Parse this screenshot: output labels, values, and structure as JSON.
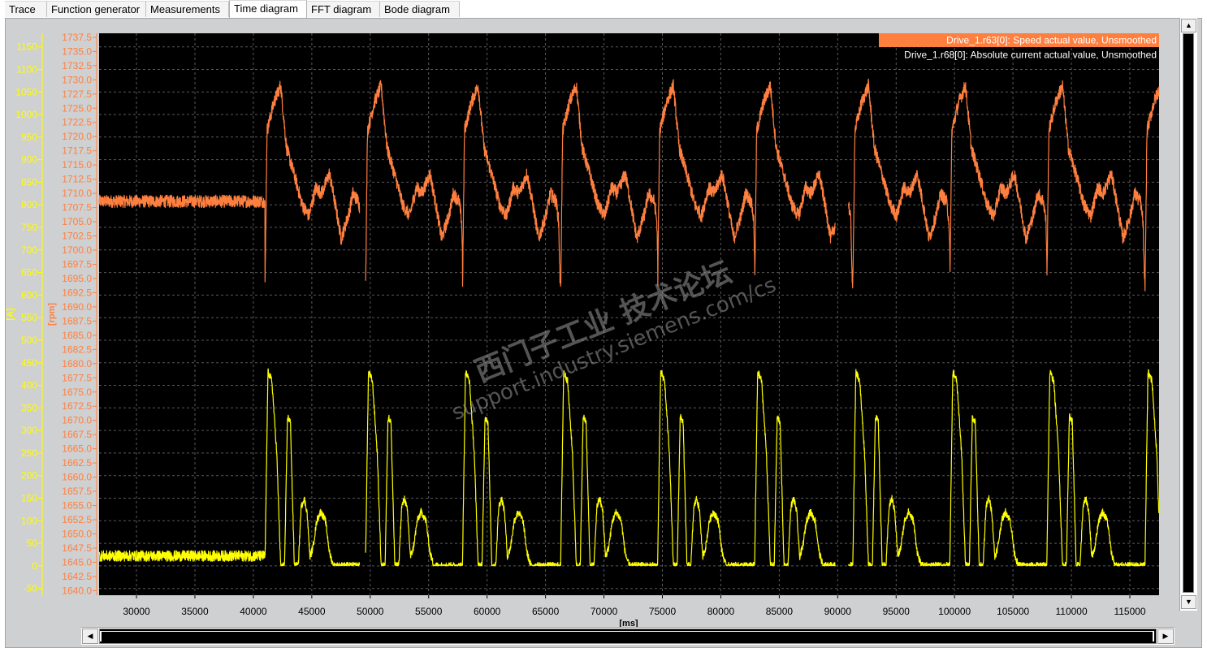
{
  "tabs": [
    {
      "label": "Trace",
      "active": false
    },
    {
      "label": "Function generator",
      "active": false
    },
    {
      "label": "Measurements",
      "active": false
    },
    {
      "label": "Time diagram",
      "active": true
    },
    {
      "label": "FFT diagram",
      "active": false
    },
    {
      "label": "Bode diagram",
      "active": false
    }
  ],
  "scroll_icons": {
    "up": "▲",
    "down": "▼",
    "left": "◀",
    "right": "▶"
  },
  "chart_data": {
    "type": "line",
    "xlabel": "[ms]",
    "xlim": [
      26800,
      117500
    ],
    "x_ticks": [
      30000,
      35000,
      40000,
      45000,
      50000,
      55000,
      60000,
      65000,
      70000,
      75000,
      80000,
      85000,
      90000,
      95000,
      100000,
      105000,
      110000,
      115000
    ],
    "grid": true,
    "legend_position": "top-right",
    "colors": {
      "speed": "#ff7f3f",
      "current": "#ffff00",
      "background": "#000000",
      "grid": "#5a5a5a"
    },
    "axes": [
      {
        "id": "current",
        "label": "[A]",
        "color": "#ffff00",
        "ylim": [
          -65,
          1180
        ],
        "ticks": [
          -50,
          0,
          50,
          100,
          150,
          200,
          250,
          300,
          350,
          400,
          450,
          500,
          550,
          600,
          650,
          700,
          750,
          800,
          850,
          900,
          950,
          1000,
          1050,
          1100,
          1150
        ]
      },
      {
        "id": "speed",
        "label": "[rpm]",
        "color": "#ff7f3f",
        "ylim": [
          1639.2,
          1738.2
        ],
        "ticks": [
          1640.0,
          1642.5,
          1645.0,
          1647.5,
          1650.0,
          1652.5,
          1655.0,
          1657.5,
          1660.0,
          1662.5,
          1665.0,
          1667.5,
          1670.0,
          1672.5,
          1675.0,
          1677.5,
          1680.0,
          1682.5,
          1685.0,
          1687.5,
          1690.0,
          1692.5,
          1695.0,
          1697.5,
          1700.0,
          1702.5,
          1705.0,
          1707.5,
          1710.0,
          1712.5,
          1715.0,
          1717.5,
          1720.0,
          1722.5,
          1725.0,
          1727.5,
          1730.0,
          1732.5,
          1735.0,
          1737.5
        ]
      }
    ],
    "series": [
      {
        "name": "Drive_1.r63[0]: Speed actual value, Unsmoothed",
        "axis": "speed",
        "color": "#ff7f3f",
        "baseline": {
          "x": [
            26800,
            41000
          ],
          "mean": 1708.6,
          "noise": 1.1
        },
        "gaps": [
          [
            49100,
            49600
          ],
          [
            89800,
            90900
          ]
        ],
        "cycle": {
          "period": 8350,
          "starts": [
            41000,
            49600,
            57900,
            66300,
            74600,
            82900,
            91300,
            99600,
            107900,
            116300
          ],
          "shape": [
            [
              0.0,
              1693.5
            ],
            [
              0.02,
              1721.0
            ],
            [
              0.09,
              1726.0
            ],
            [
              0.16,
              1729.0
            ],
            [
              0.22,
              1718.0
            ],
            [
              0.32,
              1712.0
            ],
            [
              0.38,
              1708.0
            ],
            [
              0.45,
              1706.0
            ],
            [
              0.52,
              1711.0
            ],
            [
              0.58,
              1710.0
            ],
            [
              0.66,
              1713.5
            ],
            [
              0.72,
              1708.0
            ],
            [
              0.78,
              1702.0
            ],
            [
              0.86,
              1706.5
            ],
            [
              0.9,
              1710.0
            ],
            [
              0.96,
              1708.5
            ],
            [
              0.985,
              1705.0
            ],
            [
              1.0,
              1694.0
            ]
          ]
        }
      },
      {
        "name": "Drive_1.r68[0]: Absolute current actual value, Unsmoothed",
        "axis": "current",
        "color": "#ffff00",
        "baseline": {
          "x": [
            26800,
            41000
          ],
          "mean": 22,
          "noise": 12
        },
        "gaps": [
          [
            49100,
            49600
          ],
          [
            89800,
            90900
          ]
        ],
        "cycle": {
          "period": 8350,
          "starts": [
            41000,
            49600,
            57900,
            66300,
            74600,
            82900,
            91300,
            99600,
            107900,
            116300
          ],
          "shape": [
            [
              0.0,
              15
            ],
            [
              0.03,
              430
            ],
            [
              0.07,
              410
            ],
            [
              0.12,
              250
            ],
            [
              0.16,
              0
            ],
            [
              0.2,
              0
            ],
            [
              0.23,
              330
            ],
            [
              0.26,
              320
            ],
            [
              0.3,
              0
            ],
            [
              0.34,
              0
            ],
            [
              0.37,
              130
            ],
            [
              0.4,
              150
            ],
            [
              0.43,
              120
            ],
            [
              0.46,
              20
            ],
            [
              0.49,
              40
            ],
            [
              0.53,
              100
            ],
            [
              0.57,
              120
            ],
            [
              0.62,
              100
            ],
            [
              0.66,
              30
            ],
            [
              0.7,
              0
            ],
            [
              1.0,
              0
            ]
          ]
        }
      }
    ]
  },
  "watermark": {
    "line1": "西门子工业  技术论坛",
    "line2": "support.industry.siemens.com/cs"
  }
}
